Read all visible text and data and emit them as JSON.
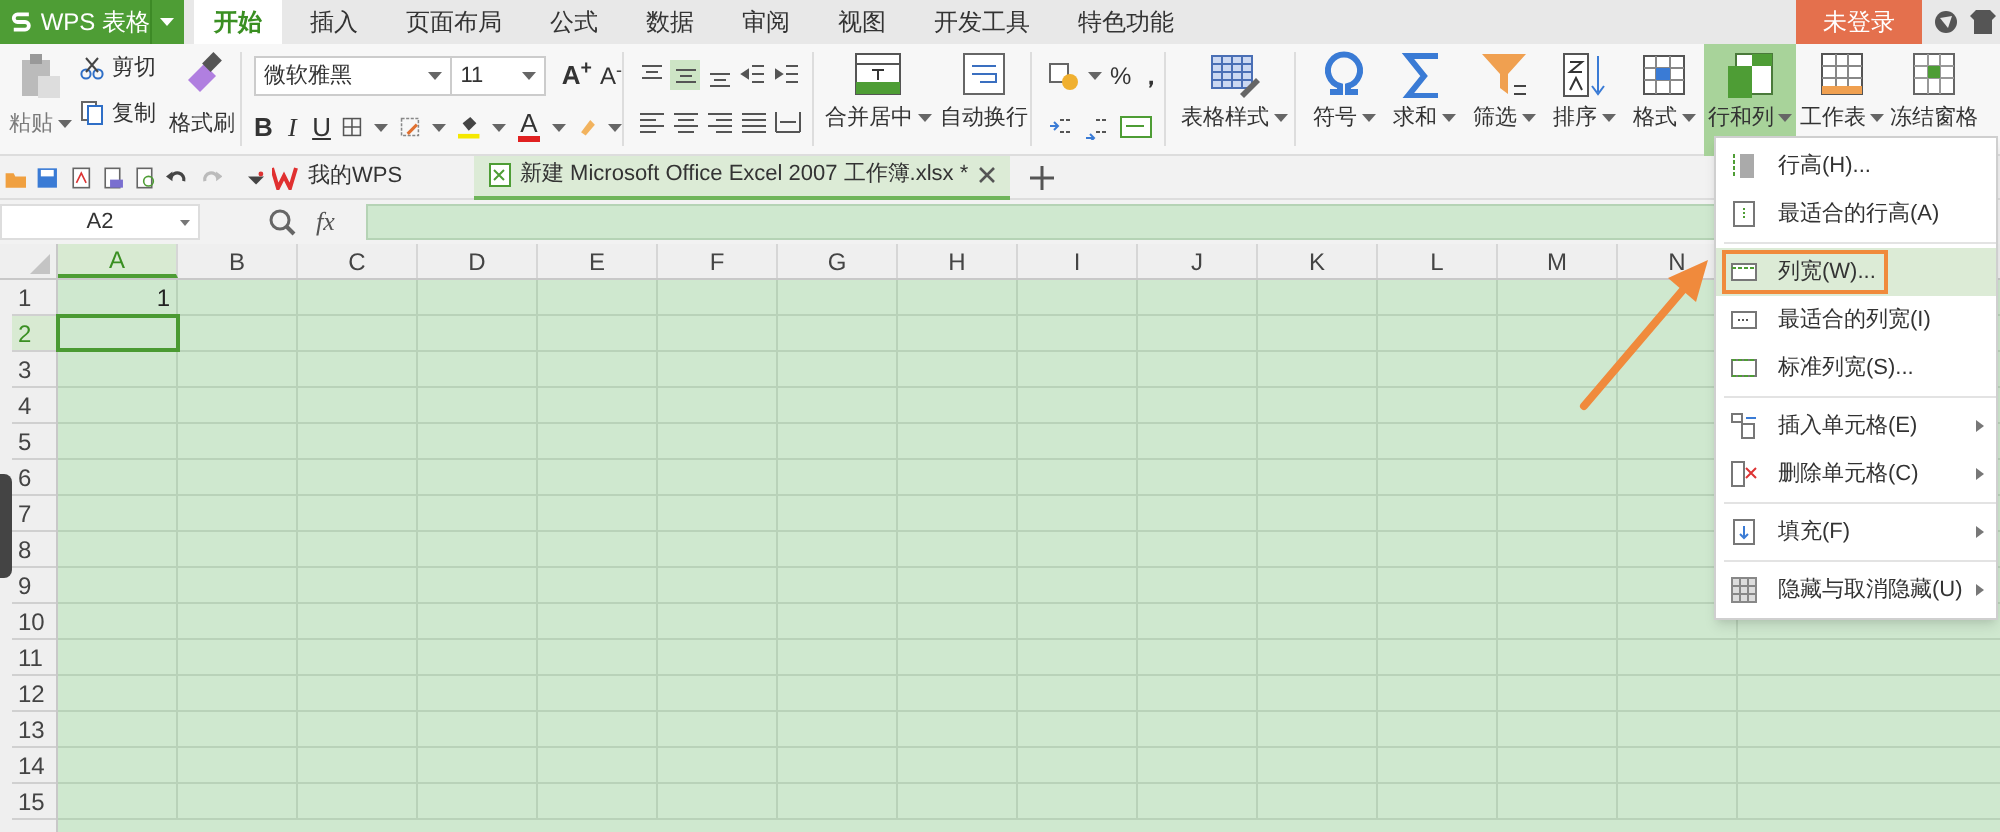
{
  "app_button": {
    "label": "WPS 表格"
  },
  "tabs": [
    {
      "label": "开始",
      "selected": true
    },
    {
      "label": "插入",
      "selected": false
    },
    {
      "label": "页面布局",
      "selected": false
    },
    {
      "label": "公式",
      "selected": false
    },
    {
      "label": "数据",
      "selected": false
    },
    {
      "label": "审阅",
      "selected": false
    },
    {
      "label": "视图",
      "selected": false
    },
    {
      "label": "开发工具",
      "selected": false
    },
    {
      "label": "特色功能",
      "selected": false
    }
  ],
  "login_button": "未登录",
  "ribbon": {
    "paste": {
      "label": "粘贴",
      "disabled": true
    },
    "cut": "剪切",
    "copy": "复制",
    "format_painter": "格式刷",
    "font_name": "微软雅黑",
    "font_size": "11",
    "grow_font": "A$^{+}$",
    "shrink_font": "A$^{-}$",
    "bold": "B",
    "italic": "I",
    "underline": "U",
    "font_color": "A",
    "percent": "%",
    "comma": "，",
    "big_buttons": [
      {
        "kind": "merge",
        "label": "合并居中",
        "selected": false
      },
      {
        "kind": "wrap",
        "label": "自动换行",
        "selected": false
      },
      {
        "kind": "style",
        "label": "表格样式",
        "selected": false
      },
      {
        "kind": "symbol",
        "label": "符号",
        "selected": false
      },
      {
        "kind": "sum",
        "label": "求和",
        "selected": false
      },
      {
        "kind": "filter",
        "label": "筛选",
        "selected": false
      },
      {
        "kind": "sort",
        "label": "排序",
        "selected": false
      },
      {
        "kind": "format",
        "label": "格式",
        "selected": false
      },
      {
        "kind": "rowcol",
        "label": "行和列",
        "selected": true
      },
      {
        "kind": "sheet",
        "label": "工作表",
        "selected": false
      },
      {
        "kind": "freeze",
        "label": "冻结窗格",
        "selected": false
      }
    ]
  },
  "doc_tabs": [
    {
      "label": "我的WPS",
      "kind": "home",
      "selected": false
    },
    {
      "label": "新建 Microsoft Office Excel 2007 工作簿.xlsx *",
      "kind": "sheet",
      "selected": true
    }
  ],
  "name_box": "A2",
  "fx_label": "fx",
  "sheet": {
    "columns": [
      {
        "label": "A",
        "selected": true
      },
      {
        "label": "B",
        "selected": false
      },
      {
        "label": "C",
        "selected": false
      },
      {
        "label": "D",
        "selected": false
      },
      {
        "label": "E",
        "selected": false
      },
      {
        "label": "F",
        "selected": false
      },
      {
        "label": "G",
        "selected": false
      },
      {
        "label": "H",
        "selected": false
      },
      {
        "label": "I",
        "selected": false
      },
      {
        "label": "J",
        "selected": false
      },
      {
        "label": "K",
        "selected": false
      },
      {
        "label": "L",
        "selected": false
      },
      {
        "label": "M",
        "selected": false
      },
      {
        "label": "N",
        "selected": false
      }
    ],
    "rows": [
      {
        "label": "1",
        "selected": false,
        "values": [
          "1"
        ]
      },
      {
        "label": "2",
        "selected": true
      },
      {
        "label": "3",
        "selected": false
      },
      {
        "label": "4",
        "selected": false
      },
      {
        "label": "5",
        "selected": false
      },
      {
        "label": "6",
        "selected": false
      },
      {
        "label": "7",
        "selected": false
      },
      {
        "label": "8",
        "selected": false
      },
      {
        "label": "9",
        "selected": false
      },
      {
        "label": "10",
        "selected": false
      },
      {
        "label": "11",
        "selected": false
      },
      {
        "label": "12",
        "selected": false
      },
      {
        "label": "13",
        "selected": false
      },
      {
        "label": "14",
        "selected": false
      },
      {
        "label": "15",
        "selected": false
      }
    ]
  },
  "menu": {
    "groups": [
      [
        {
          "kind": "row_height",
          "label": "行高(H)...",
          "selected": false,
          "submenu": false
        },
        {
          "kind": "fit_row",
          "label": "最适合的行高(A)",
          "selected": false,
          "submenu": false
        }
      ],
      [
        {
          "kind": "col_width",
          "label": "列宽(W)...",
          "selected": true,
          "submenu": false
        },
        {
          "kind": "fit_col",
          "label": "最适合的列宽(I)",
          "selected": false,
          "submenu": false
        },
        {
          "kind": "std_col",
          "label": "标准列宽(S)...",
          "selected": false,
          "submenu": false
        }
      ],
      [
        {
          "kind": "insert",
          "label": "插入单元格(E)",
          "selected": false,
          "submenu": true
        },
        {
          "kind": "delete",
          "label": "删除单元格(C)",
          "selected": false,
          "submenu": true
        }
      ],
      [
        {
          "kind": "fill",
          "label": "填充(F)",
          "selected": false,
          "submenu": true
        }
      ],
      [
        {
          "kind": "hide",
          "label": "隐藏与取消隐藏(U)",
          "selected": false,
          "submenu": true
        }
      ]
    ]
  }
}
